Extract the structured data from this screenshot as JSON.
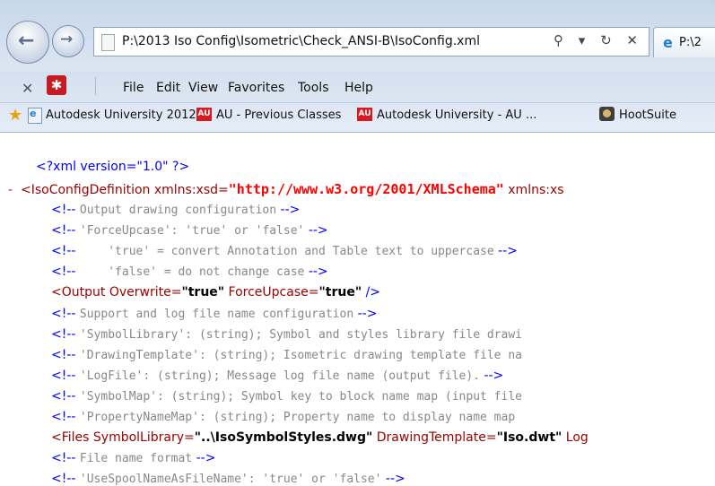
{
  "address_bar": {
    "url": "P:\\2013 Iso Config\\Isometric\\Check_ANSI-B\\IsoConfig.xml",
    "tools": "⚲ ▾ ↻ ✕"
  },
  "tab": {
    "label": "P:\\2"
  },
  "menu": {
    "items": [
      "File",
      "Edit",
      "View",
      "Favorites",
      "Tools",
      "Help"
    ]
  },
  "favorites": {
    "items": [
      "Autodesk University 2012",
      "AU - Previous Classes",
      "Autodesk University - AU ...",
      "HootSuite"
    ],
    "au_badge": "AU"
  },
  "xml": {
    "decl": "<?xml version=\"1.0\" ?>",
    "root_minus": "-",
    "root_open": "<IsoConfigDefinition",
    "root_attr": "xmlns:xsd=",
    "root_val": "\"http://www.w3.org/2001/XMLSchema\"",
    "root_attr2": "xmlns:xs",
    "c_open": "<!--",
    "c_close": "-->",
    "comments1": [
      "Output drawing configuration",
      "'ForceUpcase': 'true' or 'false'",
      "    'true' = convert Annotation and Table text to uppercase",
      "    'false' = do not change case"
    ],
    "output_tag": "<Output",
    "output_attr1": "Overwrite=",
    "output_val1": "\"true\"",
    "output_attr2": "ForceUpcase=",
    "output_val2": "\"true\"",
    "output_close": "/>",
    "comments2": [
      "Support and log file name configuration",
      "'SymbolLibrary': (string); Symbol and styles library file drawi",
      "'DrawingTemplate': (string); Isometric drawing template file na",
      "'LogFile': (string); Message log file name (output file).",
      "'SymbolMap': (string); Symbol key to block name map (input file",
      "'PropertyNameMap': (string); Property name to display name map"
    ],
    "files_tag": "<Files",
    "files_attr1": "SymbolLibrary=",
    "files_val1": "\"..\\IsoSymbolStyles.dwg\"",
    "files_attr2": "DrawingTemplate=",
    "files_val2": "\"Iso.dwt\"",
    "files_attr3": "Log",
    "comments3": [
      "File name format",
      "'UseSpoolNameAsFileName': 'true' or 'false'"
    ]
  }
}
